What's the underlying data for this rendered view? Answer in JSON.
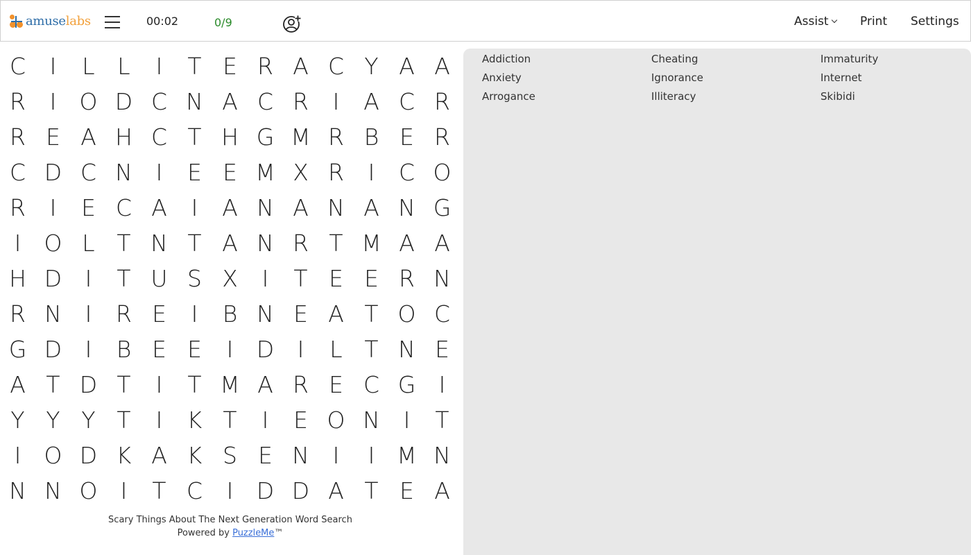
{
  "header": {
    "logo": {
      "part1": "amuse",
      "part2": "labs"
    },
    "timer": "00:02",
    "progress": "0/9",
    "nav": {
      "assist": "Assist",
      "print": "Print",
      "settings": "Settings"
    }
  },
  "grid": [
    [
      "C",
      "I",
      "L",
      "L",
      "I",
      "T",
      "E",
      "R",
      "A",
      "C",
      "Y",
      "A",
      "A"
    ],
    [
      "R",
      "I",
      "O",
      "D",
      "C",
      "N",
      "A",
      "C",
      "R",
      "I",
      "A",
      "C",
      "R"
    ],
    [
      "R",
      "E",
      "A",
      "H",
      "C",
      "T",
      "H",
      "G",
      "M",
      "R",
      "B",
      "E",
      "R"
    ],
    [
      "C",
      "D",
      "C",
      "N",
      "I",
      "E",
      "E",
      "M",
      "X",
      "R",
      "I",
      "C",
      "O"
    ],
    [
      "R",
      "I",
      "E",
      "C",
      "A",
      "I",
      "A",
      "N",
      "A",
      "N",
      "A",
      "N",
      "G"
    ],
    [
      "I",
      "O",
      "L",
      "T",
      "N",
      "T",
      "A",
      "N",
      "R",
      "T",
      "M",
      "A",
      "A"
    ],
    [
      "H",
      "D",
      "I",
      "T",
      "U",
      "S",
      "X",
      "I",
      "T",
      "E",
      "E",
      "R",
      "N"
    ],
    [
      "R",
      "N",
      "I",
      "R",
      "E",
      "I",
      "B",
      "N",
      "E",
      "A",
      "T",
      "O",
      "C"
    ],
    [
      "G",
      "D",
      "I",
      "B",
      "E",
      "E",
      "I",
      "D",
      "I",
      "L",
      "T",
      "N",
      "E"
    ],
    [
      "A",
      "T",
      "D",
      "T",
      "I",
      "T",
      "M",
      "A",
      "R",
      "E",
      "C",
      "G",
      "I"
    ],
    [
      "Y",
      "Y",
      "Y",
      "T",
      "I",
      "K",
      "T",
      "I",
      "E",
      "O",
      "N",
      "I",
      "T"
    ],
    [
      "I",
      "O",
      "D",
      "K",
      "A",
      "K",
      "S",
      "E",
      "N",
      "I",
      "I",
      "M",
      "N"
    ],
    [
      "N",
      "N",
      "O",
      "I",
      "T",
      "C",
      "I",
      "D",
      "D",
      "A",
      "T",
      "E",
      "A"
    ]
  ],
  "words": [
    "Addiction",
    "Cheating",
    "Immaturity",
    "Anxiety",
    "Ignorance",
    "Internet",
    "Arrogance",
    "Illiteracy",
    "Skibidi"
  ],
  "footer": {
    "title": "Scary Things About The Next Generation Word Search",
    "powered_prefix": "Powered by ",
    "powered_link": "PuzzleMe",
    "tm": "™"
  },
  "colors": {
    "logo_blue": "#2f6ea8",
    "logo_orange": "#f2912b",
    "progress_green": "#2a8a2a",
    "link_blue": "#3a6fd8",
    "panel_bg": "#e8e8e8"
  }
}
